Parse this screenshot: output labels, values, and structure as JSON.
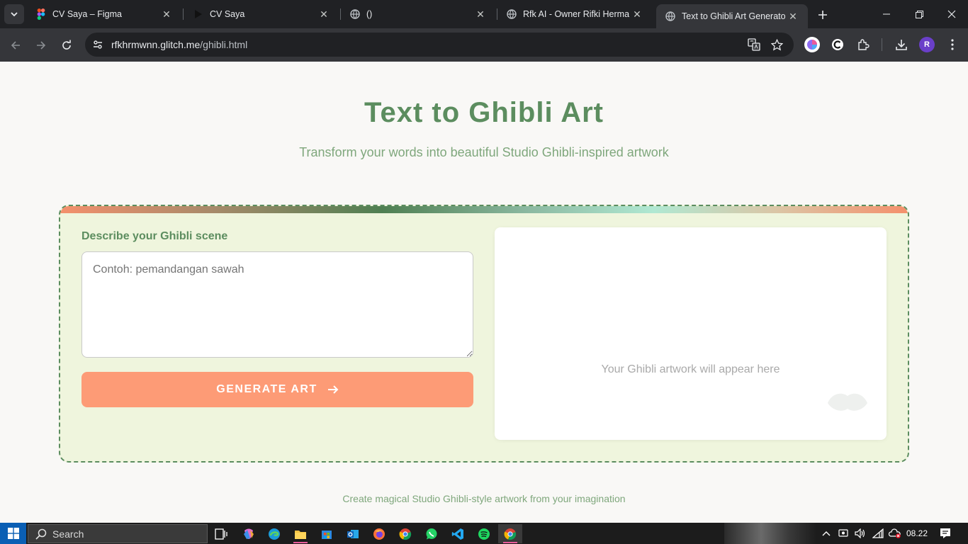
{
  "browser": {
    "tabs": [
      {
        "title": "CV Saya – Figma",
        "icon": "figma-icon",
        "active": false
      },
      {
        "title": "CV Saya",
        "icon": "play-icon",
        "active": false
      },
      {
        "title": "()",
        "icon": "globe-icon",
        "active": false
      },
      {
        "title": "Rfk AI - Owner Rifki Hermaw",
        "icon": "globe-icon",
        "active": false
      },
      {
        "title": "Text to Ghibli Art Generator",
        "icon": "globe-icon",
        "active": true
      }
    ],
    "url_host": "rfkhrmwnn.glitch.me",
    "url_path": "/ghibli.html",
    "profile_initial": "R"
  },
  "page": {
    "title": "Text to Ghibli Art",
    "subtitle": "Transform your words into beautiful Studio Ghibli-inspired artwork",
    "prompt_label": "Describe your Ghibli scene",
    "prompt_placeholder": "Contoh: pemandangan sawah",
    "generate_button": "GENERATE ART",
    "preview_placeholder": "Your Ghibli artwork will appear here",
    "footer": "Create magical Studio Ghibli-style artwork from your imagination"
  },
  "taskbar": {
    "search_label": "Search",
    "clock": "08.22"
  },
  "colors": {
    "title_green": "#5c8d5f",
    "subtitle_green": "#7fa77c",
    "button_peach": "#fd9b76",
    "card_bg": "#eff5dd"
  }
}
